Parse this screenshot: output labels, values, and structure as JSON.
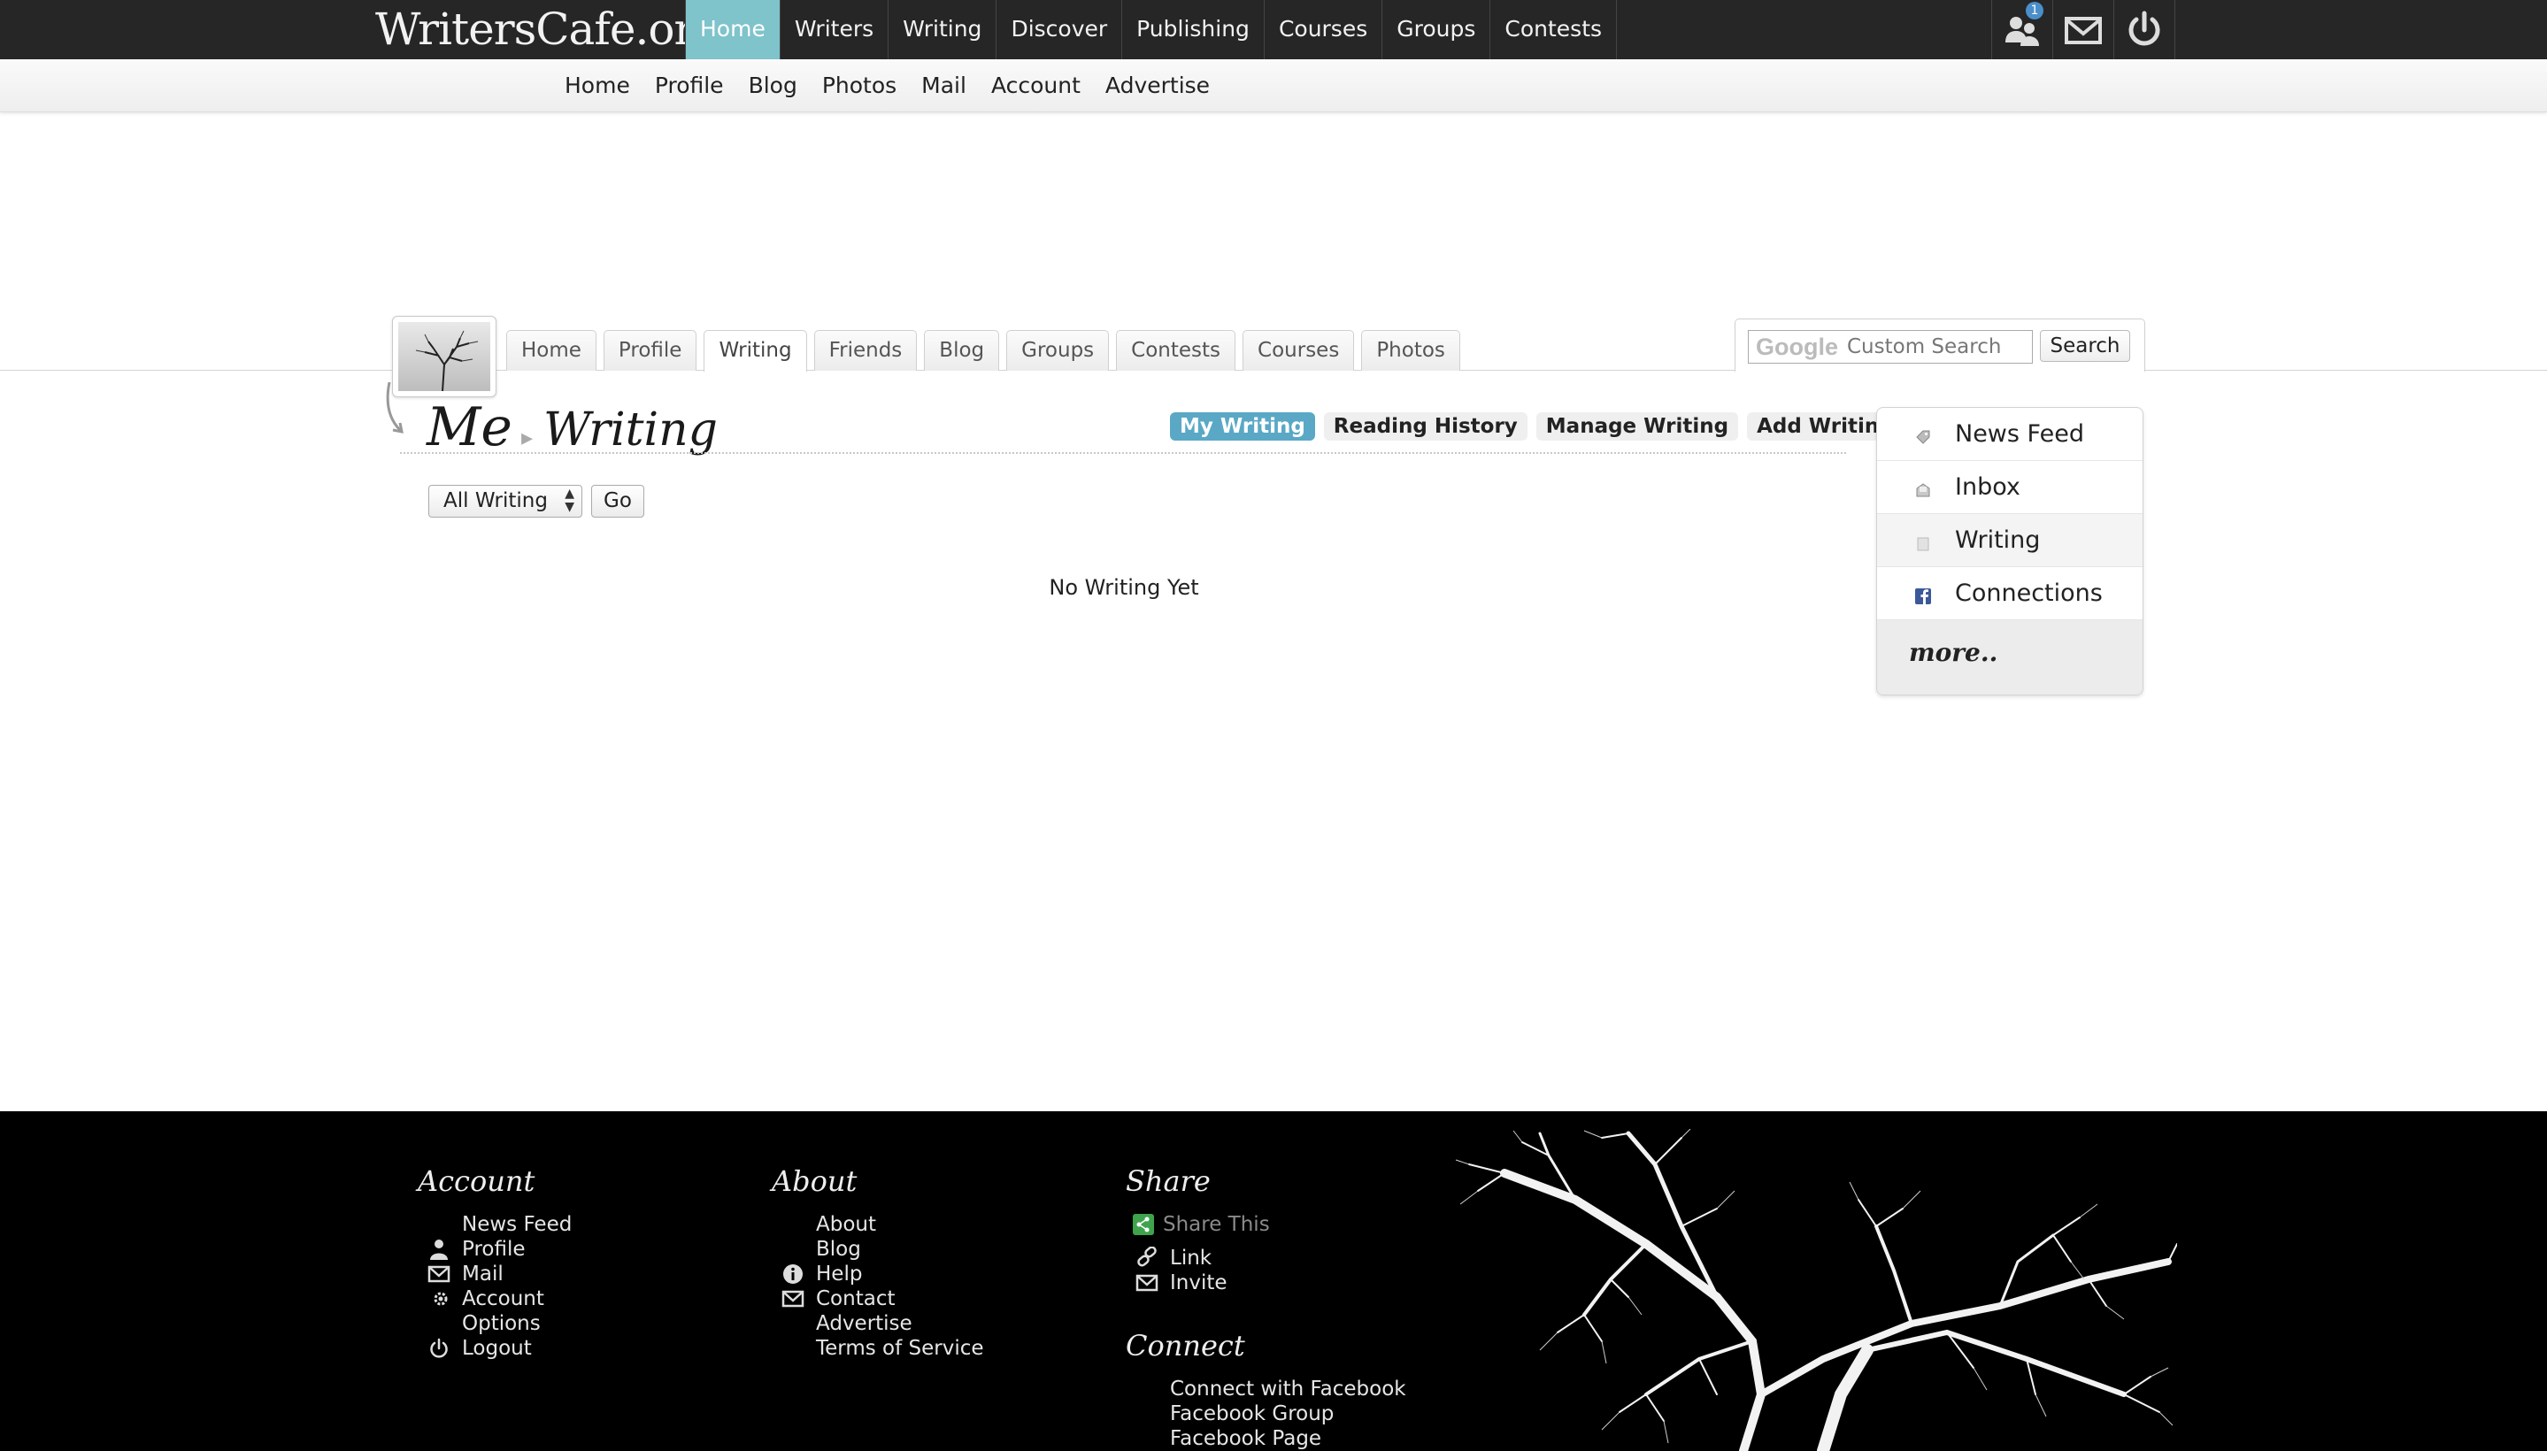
{
  "top": {
    "logo": "WritersCafe.org",
    "nav": [
      {
        "label": "Home",
        "active": true
      },
      {
        "label": "Writers"
      },
      {
        "label": "Writing"
      },
      {
        "label": "Discover"
      },
      {
        "label": "Publishing"
      },
      {
        "label": "Courses"
      },
      {
        "label": "Groups"
      },
      {
        "label": "Contests"
      }
    ],
    "icons": [
      "people-icon",
      "mail-icon",
      "power-icon"
    ],
    "notification_count": "1"
  },
  "subnav": [
    "Home",
    "Profile",
    "Blog",
    "Photos",
    "Mail",
    "Account",
    "Advertise"
  ],
  "profile_tabs": [
    {
      "label": "Home"
    },
    {
      "label": "Profile"
    },
    {
      "label": "Writing",
      "active": true
    },
    {
      "label": "Friends"
    },
    {
      "label": "Blog"
    },
    {
      "label": "Groups"
    },
    {
      "label": "Contests"
    },
    {
      "label": "Courses"
    },
    {
      "label": "Photos"
    }
  ],
  "search": {
    "placeholder": "Custom Search",
    "google_label": "Google",
    "button": "Search"
  },
  "page": {
    "crumb_root": "Me",
    "title": "Writing",
    "subtabs": [
      {
        "label": "My Writing",
        "active": true
      },
      {
        "label": "Reading History"
      },
      {
        "label": "Manage Writing"
      },
      {
        "label": "Add Writing"
      }
    ],
    "filter_value": "All Writing",
    "go": "Go",
    "empty_message": "No Writing Yet"
  },
  "sidemenu": {
    "items": [
      {
        "label": "News Feed",
        "icon": "tag-icon"
      },
      {
        "label": "Inbox",
        "icon": "inbox-icon"
      },
      {
        "label": "Writing",
        "icon": "document-icon",
        "active": true
      },
      {
        "label": "Connections",
        "icon": "facebook-icon"
      }
    ],
    "more": "more.."
  },
  "footer": {
    "account": {
      "title": "Account",
      "links": [
        "News Feed",
        "Profile",
        "Mail",
        "Account",
        "Options",
        "Logout"
      ]
    },
    "about": {
      "title": "About",
      "links": [
        "About",
        "Blog",
        "Help",
        "Contact",
        "Advertise",
        "Terms of Service"
      ]
    },
    "share": {
      "title": "Share",
      "share_this": "Share This",
      "links": [
        "Link",
        "Invite"
      ]
    },
    "connect": {
      "title": "Connect",
      "links": [
        "Connect with Facebook",
        "Facebook Group",
        "Facebook Page"
      ]
    }
  },
  "colors": {
    "top_bar": "#262626",
    "active_nav": "#7fc3cb",
    "active_subtab": "#5aa8c6",
    "footer": "#000000"
  }
}
